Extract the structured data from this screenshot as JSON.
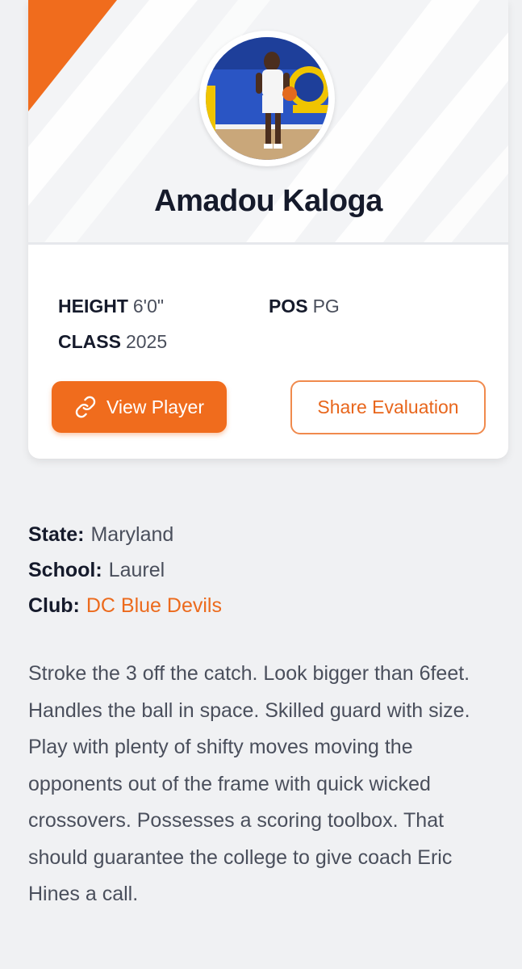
{
  "player": {
    "name": "Amadou Kaloga",
    "photo_alt": "Player photo"
  },
  "stats": {
    "height_label": "HEIGHT",
    "height_value": "6'0\"",
    "pos_label": "POS",
    "pos_value": "PG",
    "class_label": "CLASS",
    "class_value": "2025"
  },
  "actions": {
    "view_player_label": "View Player",
    "view_player_icon": "link-icon",
    "share_label": "Share Evaluation"
  },
  "details": {
    "state_label": "State:",
    "state_value": "Maryland",
    "school_label": "School:",
    "school_value": "Laurel",
    "club_label": "Club:",
    "club_value": "DC Blue Devils"
  },
  "evaluation": "Stroke the 3 off the catch. Look bigger than 6feet. Handles the ball in space. Skilled guard with size. Play with plenty of shifty moves moving the opponents out of the frame with quick wicked crossovers. Possesses a scoring toolbox. That should guarantee the college to give coach Eric Hines a call.",
  "colors": {
    "accent": "#f06c1d",
    "text_dark": "#151a2b",
    "text_muted": "#4a4f5c",
    "page_bg": "#f0f1f3"
  }
}
